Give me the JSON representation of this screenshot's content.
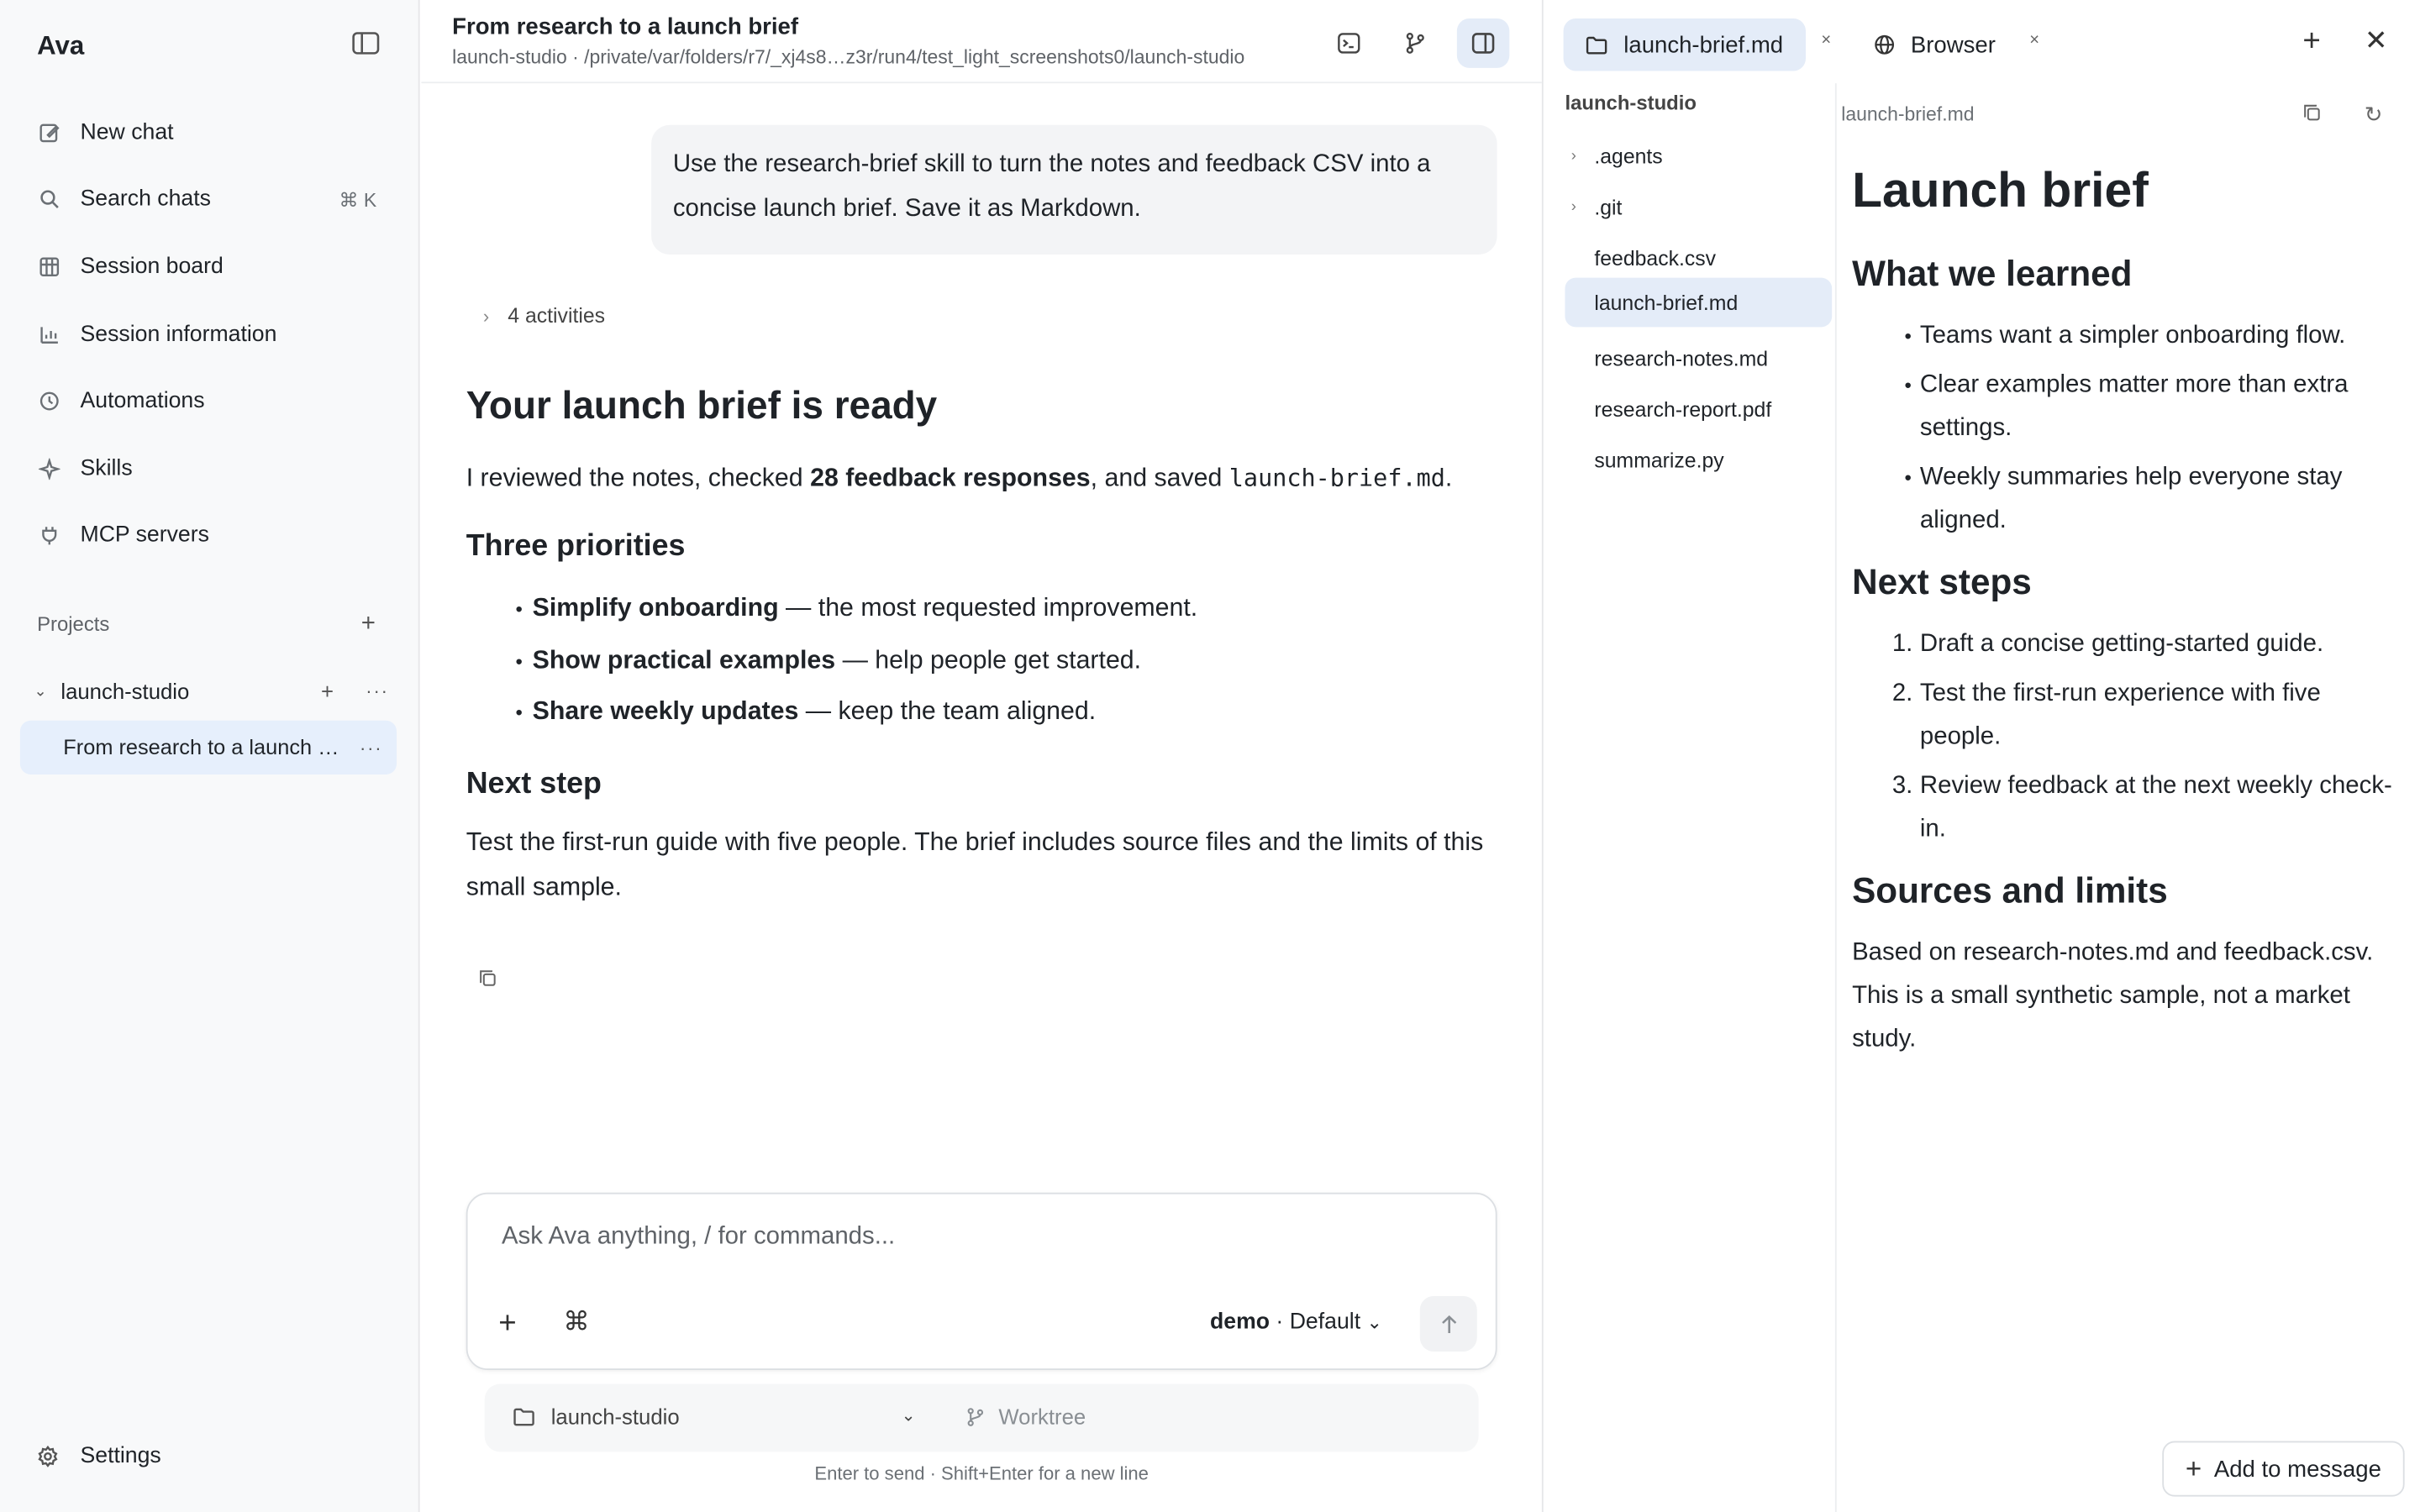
{
  "sidebar": {
    "brand": "Ava",
    "nav": [
      {
        "label": "New chat",
        "icon": "edit-icon"
      },
      {
        "label": "Search chats",
        "icon": "search-icon",
        "shortcut": "⌘ K"
      },
      {
        "label": "Session board",
        "icon": "board-icon"
      },
      {
        "label": "Session information",
        "icon": "chart-icon"
      },
      {
        "label": "Automations",
        "icon": "clock-icon"
      },
      {
        "label": "Skills",
        "icon": "sparkle-icon"
      },
      {
        "label": "MCP servers",
        "icon": "plug-icon"
      }
    ],
    "projects_label": "Projects",
    "project_name": "launch-studio",
    "chat_item": "From research to a launch brief",
    "settings": "Settings"
  },
  "header": {
    "title": "From research to a launch brief",
    "path": "launch-studio · /private/var/folders/r7/_xj4s8…z3r/run4/test_light_screenshots0/launch-studio"
  },
  "conversation": {
    "user_message": "Use the research-brief skill to turn the notes and feedback CSV into a concise launch brief. Save it as Markdown.",
    "activities": "4 activities",
    "heading": "Your launch brief is ready",
    "intro_pre": "I reviewed the notes, checked ",
    "intro_bold": "28 feedback responses",
    "intro_mid": ", and saved ",
    "intro_code": "launch-brief.md",
    "intro_post": ".",
    "priorities_heading": "Three priorities",
    "priorities": [
      {
        "bold": "Simplify onboarding",
        "text": " — the most requested improvement."
      },
      {
        "bold": "Show practical examples",
        "text": " — help people get started."
      },
      {
        "bold": "Share weekly updates",
        "text": " — keep the team aligned."
      }
    ],
    "next_heading": "Next step",
    "next_text": "Test the first-run guide with five people. The brief includes source files and the limits of this small sample."
  },
  "composer": {
    "placeholder": "Ask Ava anything, / for commands...",
    "model_name": "demo",
    "model_mode": "· Default",
    "project": "launch-studio",
    "worktree": "Worktree",
    "hint": "Enter to send · Shift+Enter for a new line"
  },
  "right_panel": {
    "tabs": [
      {
        "label": "launch-brief.md",
        "icon": "folder-icon",
        "active": true
      },
      {
        "label": "Browser",
        "icon": "globe-icon",
        "active": false
      }
    ],
    "tree_root": "launch-studio",
    "files": [
      {
        "name": ".agents",
        "folder": true,
        "selected": false
      },
      {
        "name": ".git",
        "folder": true,
        "selected": false
      },
      {
        "name": "feedback.csv",
        "folder": false,
        "selected": false
      },
      {
        "name": "launch-brief.md",
        "folder": false,
        "selected": true
      },
      {
        "name": "research-notes.md",
        "folder": false,
        "selected": false
      },
      {
        "name": "research-report.pdf",
        "folder": false,
        "selected": false
      },
      {
        "name": "summarize.py",
        "folder": false,
        "selected": false
      }
    ],
    "preview_file": "launch-brief.md",
    "doc": {
      "title": "Launch brief",
      "learned_heading": "What we learned",
      "learned": [
        "Teams want a simpler onboarding flow.",
        "Clear examples matter more than extra settings.",
        "Weekly summaries help everyone stay aligned."
      ],
      "steps_heading": "Next steps",
      "steps": [
        "Draft a concise getting-started guide.",
        "Test the first-run experience with five people.",
        "Review feedback at the next weekly check-in."
      ],
      "sources_heading": "Sources and limits",
      "sources_text": "Based on research-notes.md and feedback.csv. This is a small synthetic sample, not a market study."
    },
    "add_to_message": "Add to message"
  },
  "colors": {
    "accent_bg": "#e4ecf8",
    "selected_chat_bg": "#e6effc",
    "sidebar_bg": "#f8f9fa"
  }
}
